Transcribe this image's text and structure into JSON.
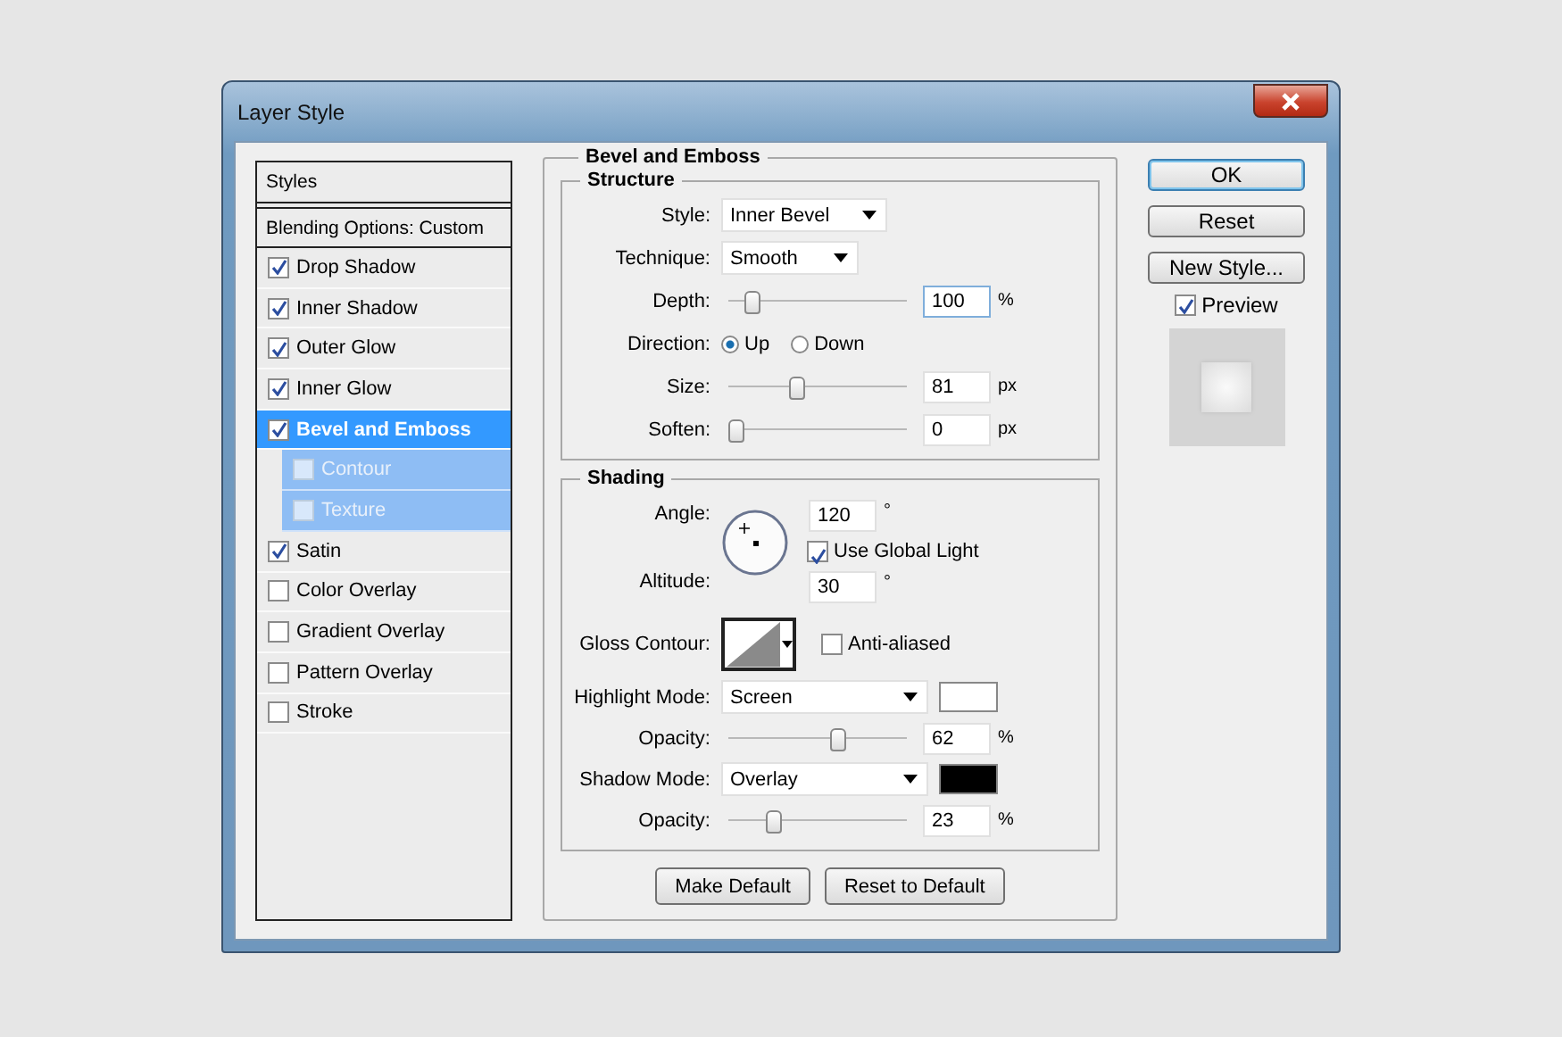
{
  "window": {
    "title": "Layer Style"
  },
  "sidebar": {
    "header": "Styles",
    "blending": "Blending Options: Custom",
    "items": [
      {
        "label": "Drop Shadow",
        "checked": true,
        "selected": false
      },
      {
        "label": "Inner Shadow",
        "checked": true,
        "selected": false
      },
      {
        "label": "Outer Glow",
        "checked": true,
        "selected": false
      },
      {
        "label": "Inner Glow",
        "checked": true,
        "selected": false
      },
      {
        "label": "Bevel and Emboss",
        "checked": true,
        "selected": true,
        "children": [
          {
            "label": "Contour",
            "checked": false,
            "selected": false
          },
          {
            "label": "Texture",
            "checked": false,
            "selected": false
          }
        ]
      },
      {
        "label": "Satin",
        "checked": true,
        "selected": false
      },
      {
        "label": "Color Overlay",
        "checked": false,
        "selected": false
      },
      {
        "label": "Gradient Overlay",
        "checked": false,
        "selected": false
      },
      {
        "label": "Pattern Overlay",
        "checked": false,
        "selected": false
      },
      {
        "label": "Stroke",
        "checked": false,
        "selected": false
      }
    ]
  },
  "panel": {
    "title": "Bevel and Emboss",
    "structure": {
      "title": "Structure",
      "style": {
        "label": "Style:",
        "value": "Inner Bevel"
      },
      "technique": {
        "label": "Technique:",
        "value": "Smooth"
      },
      "depth": {
        "label": "Depth:",
        "level": 0.1,
        "value": "100",
        "unit": "%"
      },
      "direction": {
        "label": "Direction:",
        "options": [
          {
            "label": "Up",
            "selected": true
          },
          {
            "label": "Down",
            "selected": false
          }
        ]
      },
      "size": {
        "label": "Size:",
        "level": 0.37,
        "value": "81",
        "unit": "px"
      },
      "soften": {
        "label": "Soften:",
        "level": 0,
        "value": "0",
        "unit": "px"
      }
    },
    "shading": {
      "title": "Shading",
      "angle": {
        "label": "Angle:",
        "value": "120",
        "unit": "°"
      },
      "global_light": {
        "label": "Use Global Light",
        "checked": true
      },
      "altitude": {
        "label": "Altitude:",
        "value": "30",
        "unit": "°"
      },
      "gloss_contour": {
        "label": "Gloss Contour:"
      },
      "anti_aliased": {
        "label": "Anti-aliased",
        "checked": false
      },
      "highlight_mode": {
        "label": "Highlight Mode:",
        "value": "Screen",
        "color": "#ffffff"
      },
      "highlight_opacity": {
        "label": "Opacity:",
        "level": 0.62,
        "value": "62",
        "unit": "%"
      },
      "shadow_mode": {
        "label": "Shadow Mode:",
        "value": "Overlay",
        "color": "#000000"
      },
      "shadow_opacity": {
        "label": "Opacity:",
        "level": 0.23,
        "value": "23",
        "unit": "%"
      }
    },
    "buttons": [
      "Make Default",
      "Reset to Default"
    ]
  },
  "actions": [
    {
      "label": "OK",
      "default": true
    },
    {
      "label": "Reset",
      "default": false
    },
    {
      "label": "New Style...",
      "default": false
    }
  ],
  "preview": {
    "label": "Preview",
    "checked": true
  }
}
